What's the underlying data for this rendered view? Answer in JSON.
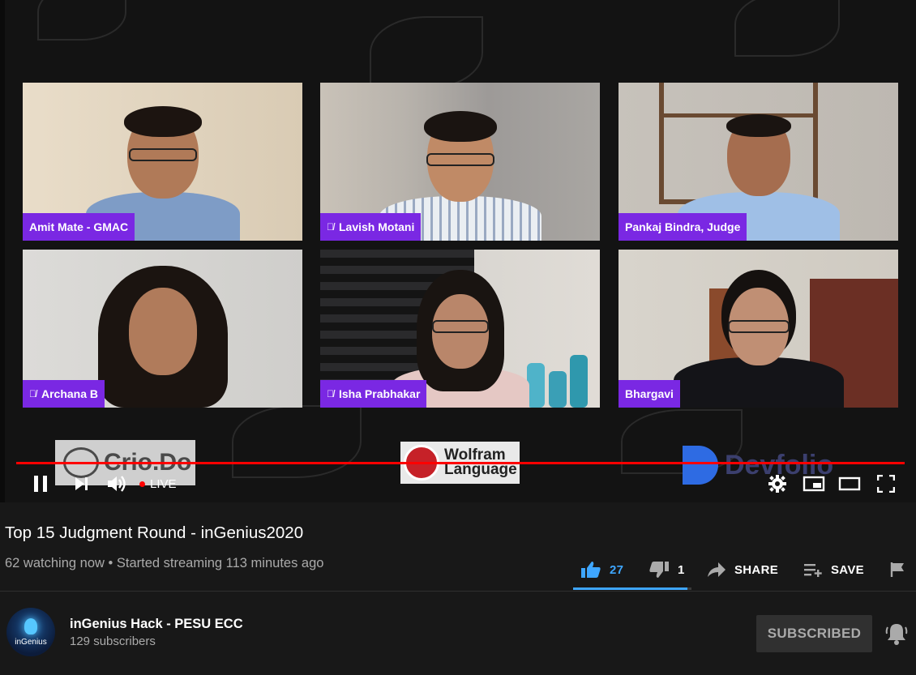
{
  "video": {
    "participants": [
      {
        "name": "Amit Mate - GMAC",
        "muted": false
      },
      {
        "name": "Lavish Motani",
        "muted": true
      },
      {
        "name": "Pankaj Bindra, Judge",
        "muted": false
      },
      {
        "name": "Archana B",
        "muted": true
      },
      {
        "name": "Isha Prabhakar",
        "muted": true
      },
      {
        "name": "Bhargavi",
        "muted": false
      }
    ],
    "sponsors": {
      "crio": "Crio.Do",
      "wolfram_line1": "Wolfram",
      "wolfram_line2": "Language",
      "devfolio": "Devfolio"
    },
    "live_label": "LIVE",
    "colors": {
      "progress": "#ff0000",
      "nametag": "#7a28e3",
      "like_accent": "#3ea6ff"
    }
  },
  "info": {
    "title": "Top 15 Judgment Round - inGenius2020",
    "meta": "62 watching now • Started streaming 113 minutes ago",
    "likes": "27",
    "dislikes": "1",
    "like_ratio": 0.964,
    "share_label": "SHARE",
    "save_label": "SAVE"
  },
  "channel": {
    "name": "inGenius Hack - PESU ECC",
    "subscribers": "129 subscribers",
    "subscribed_label": "SUBSCRIBED",
    "avatar_text": "inGenius"
  },
  "icons": [
    "pause-icon",
    "next-icon",
    "volume-icon",
    "settings-icon",
    "miniplayer-icon",
    "theater-icon",
    "fullscreen-icon",
    "thumbs-up-icon",
    "thumbs-down-icon",
    "share-icon",
    "save-playlist-icon",
    "flag-icon",
    "bell-icon"
  ]
}
